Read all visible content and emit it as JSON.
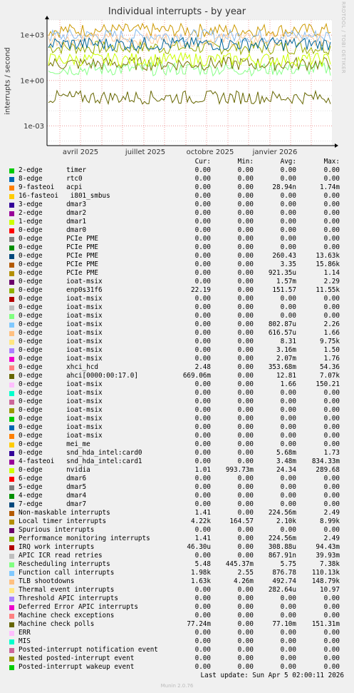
{
  "title": "Individual interrupts - by year",
  "ylabel": "interrupts / second",
  "watermark": "RRDTOOL / TOBI OETIKER",
  "footer": "Munin 2.0.76",
  "last_update": "Last update: Sun Apr  5 02:00:11 2026",
  "columns": {
    "cur": "Cur:",
    "min": "Min:",
    "avg": "Avg:",
    "max": "Max:"
  },
  "chart_data": {
    "type": "line",
    "title": "Individual interrupts - by year",
    "ylabel": "interrupts / second",
    "yscale": "log",
    "ylim": [
      5e-05,
      10000
    ],
    "yticks": [
      "1e+03",
      "1e+00",
      "1e-03"
    ],
    "xticks": [
      "avril 2025",
      "juillet 2025",
      "octobre 2025",
      "janvier 2026"
    ],
    "grid": true,
    "series": [
      {
        "name": "enp0s31f6",
        "color": "#99aa00",
        "avg": 151.57
      },
      {
        "name": "Local timer interrupts",
        "color": "#cc9900",
        "avg": 2100
      },
      {
        "name": "Function call interrupts",
        "color": "#88bbee",
        "avg": 876.78
      },
      {
        "name": "TLB shootdowns",
        "color": "#ffcc99",
        "avg": 492.74
      },
      {
        "name": "Rescheduling interrupts",
        "color": "#88ff88",
        "avg": 5.75
      },
      {
        "name": "ahci[0000:00:17.0]",
        "color": "#777700",
        "avg": 12.81
      },
      {
        "name": "nvidia",
        "color": "#ccff00",
        "avg": 24.34
      },
      {
        "name": "PCIe PME",
        "color": "#006699",
        "avg": 260.43
      },
      {
        "name": "Machine check polls",
        "color": "#666600",
        "avg": 0.0771
      }
    ]
  },
  "rows": [
    {
      "label": "2-edge      timer",
      "color": "#00cc00",
      "cur": "0.00",
      "min": "0.00",
      "avg": "0.00",
      "max": "0.00"
    },
    {
      "label": "8-edge      rtc0",
      "color": "#0066b3",
      "cur": "0.00",
      "min": "0.00",
      "avg": "0.00",
      "max": "0.00"
    },
    {
      "label": "9-fasteoi   acpi",
      "color": "#ff8000",
      "cur": "0.00",
      "min": "0.00",
      "avg": "28.94n",
      "max": "1.74m"
    },
    {
      "label": "16-fasteoi   i801_smbus",
      "color": "#ffcc00",
      "cur": "0.00",
      "min": "0.00",
      "avg": "0.00",
      "max": "0.00"
    },
    {
      "label": "3-edge      dmar3",
      "color": "#330099",
      "cur": "0.00",
      "min": "0.00",
      "avg": "0.00",
      "max": "0.00"
    },
    {
      "label": "2-edge      dmar2",
      "color": "#990099",
      "cur": "0.00",
      "min": "0.00",
      "avg": "0.00",
      "max": "0.00"
    },
    {
      "label": "1-edge      dmar1",
      "color": "#ccff00",
      "cur": "0.00",
      "min": "0.00",
      "avg": "0.00",
      "max": "0.00"
    },
    {
      "label": "0-edge      dmar0",
      "color": "#ff0000",
      "cur": "0.00",
      "min": "0.00",
      "avg": "0.00",
      "max": "0.00"
    },
    {
      "label": "0-edge      PCIe PME",
      "color": "#808080",
      "cur": "0.00",
      "min": "0.00",
      "avg": "0.00",
      "max": "0.00"
    },
    {
      "label": "0-edge      PCIe PME",
      "color": "#008f00",
      "cur": "0.00",
      "min": "0.00",
      "avg": "0.00",
      "max": "0.00"
    },
    {
      "label": "0-edge      PCIe PME",
      "color": "#00487d",
      "cur": "0.00",
      "min": "0.00",
      "avg": "260.43",
      "max": "13.63k"
    },
    {
      "label": "0-edge      PCIe PME",
      "color": "#b35a00",
      "cur": "0.00",
      "min": "0.00",
      "avg": "3.35",
      "max": "15.86k"
    },
    {
      "label": "0-edge      PCIe PME",
      "color": "#b38f00",
      "cur": "0.00",
      "min": "0.00",
      "avg": "921.35u",
      "max": "1.14"
    },
    {
      "label": "0-edge      ioat-msix",
      "color": "#6b006b",
      "cur": "0.00",
      "min": "0.00",
      "avg": "1.57m",
      "max": "2.29"
    },
    {
      "label": "0-edge      enp0s31f6",
      "color": "#8fb300",
      "cur": "22.19",
      "min": "0.00",
      "avg": "151.57",
      "max": "11.55k"
    },
    {
      "label": "0-edge      ioat-msix",
      "color": "#b30000",
      "cur": "0.00",
      "min": "0.00",
      "avg": "0.00",
      "max": "0.00"
    },
    {
      "label": "0-edge      ioat-msix",
      "color": "#bebebe",
      "cur": "0.00",
      "min": "0.00",
      "avg": "0.00",
      "max": "0.00"
    },
    {
      "label": "0-edge      ioat-msix",
      "color": "#80ff80",
      "cur": "0.00",
      "min": "0.00",
      "avg": "0.00",
      "max": "0.00"
    },
    {
      "label": "0-edge      ioat-msix",
      "color": "#80c9ff",
      "cur": "0.00",
      "min": "0.00",
      "avg": "802.87u",
      "max": "2.26"
    },
    {
      "label": "0-edge      ioat-msix",
      "color": "#ffc080",
      "cur": "0.00",
      "min": "0.00",
      "avg": "616.57u",
      "max": "1.66"
    },
    {
      "label": "0-edge      ioat-msix",
      "color": "#ffe680",
      "cur": "0.00",
      "min": "0.00",
      "avg": "8.31",
      "max": "9.75k"
    },
    {
      "label": "0-edge      ioat-msix",
      "color": "#aa80ff",
      "cur": "0.00",
      "min": "0.00",
      "avg": "3.16m",
      "max": "1.50"
    },
    {
      "label": "0-edge      ioat-msix",
      "color": "#ee00cc",
      "cur": "0.00",
      "min": "0.00",
      "avg": "2.07m",
      "max": "1.76"
    },
    {
      "label": "0-edge      xhci_hcd",
      "color": "#ff8080",
      "cur": "2.48",
      "min": "0.00",
      "avg": "353.68m",
      "max": "54.36"
    },
    {
      "label": "0-edge      ahci[0000:00:17.0]",
      "color": "#666600",
      "cur": "669.06m",
      "min": "0.00",
      "avg": "12.81",
      "max": "7.07k"
    },
    {
      "label": "0-edge      ioat-msix",
      "color": "#ffbfff",
      "cur": "0.00",
      "min": "0.00",
      "avg": "1.66",
      "max": "150.21"
    },
    {
      "label": "0-edge      ioat-msix",
      "color": "#00ffcc",
      "cur": "0.00",
      "min": "0.00",
      "avg": "0.00",
      "max": "0.00"
    },
    {
      "label": "0-edge      ioat-msix",
      "color": "#cc6699",
      "cur": "0.00",
      "min": "0.00",
      "avg": "0.00",
      "max": "0.00"
    },
    {
      "label": "0-edge      ioat-msix",
      "color": "#999900",
      "cur": "0.00",
      "min": "0.00",
      "avg": "0.00",
      "max": "0.00"
    },
    {
      "label": "0-edge      ioat-msix",
      "color": "#00cc00",
      "cur": "0.00",
      "min": "0.00",
      "avg": "0.00",
      "max": "0.00"
    },
    {
      "label": "0-edge      ioat-msix",
      "color": "#0066b3",
      "cur": "0.00",
      "min": "0.00",
      "avg": "0.00",
      "max": "0.00"
    },
    {
      "label": "0-edge      ioat-msix",
      "color": "#ff8000",
      "cur": "0.00",
      "min": "0.00",
      "avg": "0.00",
      "max": "0.00"
    },
    {
      "label": "0-edge      mei_me",
      "color": "#ffcc00",
      "cur": "0.00",
      "min": "0.00",
      "avg": "0.00",
      "max": "0.00"
    },
    {
      "label": "0-edge      snd_hda_intel:card0",
      "color": "#330099",
      "cur": "0.00",
      "min": "0.00",
      "avg": "5.68m",
      "max": "1.73"
    },
    {
      "label": "4-fasteoi   snd_hda_intel:card1",
      "color": "#990099",
      "cur": "0.00",
      "min": "0.00",
      "avg": "3.48m",
      "max": "834.33m"
    },
    {
      "label": "0-edge      nvidia",
      "color": "#ccff00",
      "cur": "1.01",
      "min": "993.73m",
      "avg": "24.34",
      "max": "289.68"
    },
    {
      "label": "6-edge      dmar6",
      "color": "#ff0000",
      "cur": "0.00",
      "min": "0.00",
      "avg": "0.00",
      "max": "0.00"
    },
    {
      "label": "5-edge      dmar5",
      "color": "#808080",
      "cur": "0.00",
      "min": "0.00",
      "avg": "0.00",
      "max": "0.00"
    },
    {
      "label": "4-edge      dmar4",
      "color": "#008f00",
      "cur": "0.00",
      "min": "0.00",
      "avg": "0.00",
      "max": "0.00"
    },
    {
      "label": "7-edge      dmar7",
      "color": "#00487d",
      "cur": "0.00",
      "min": "0.00",
      "avg": "0.00",
      "max": "0.00"
    },
    {
      "label": "Non-maskable interrupts",
      "color": "#b35a00",
      "cur": "1.41",
      "min": "0.00",
      "avg": "224.56m",
      "max": "2.49"
    },
    {
      "label": "Local timer interrupts",
      "color": "#b38f00",
      "cur": "4.22k",
      "min": "164.57",
      "avg": "2.10k",
      "max": "8.99k"
    },
    {
      "label": "Spurious interrupts",
      "color": "#6b006b",
      "cur": "0.00",
      "min": "0.00",
      "avg": "0.00",
      "max": "0.00"
    },
    {
      "label": "Performance monitoring interrupts",
      "color": "#8fb300",
      "cur": "1.41",
      "min": "0.00",
      "avg": "224.56m",
      "max": "2.49"
    },
    {
      "label": "IRQ work interrupts",
      "color": "#b30000",
      "cur": "46.30u",
      "min": "0.00",
      "avg": "308.88u",
      "max": "94.43m"
    },
    {
      "label": "APIC ICR read retries",
      "color": "#bebebe",
      "cur": "0.00",
      "min": "0.00",
      "avg": "867.91n",
      "max": "39.93m"
    },
    {
      "label": "Rescheduling interrupts",
      "color": "#80ff80",
      "cur": "5.48",
      "min": "445.37m",
      "avg": "5.75",
      "max": "7.38k"
    },
    {
      "label": "Function call interrupts",
      "color": "#80c9ff",
      "cur": "1.98k",
      "min": "2.55",
      "avg": "876.78",
      "max": "110.13k"
    },
    {
      "label": "TLB shootdowns",
      "color": "#ffc080",
      "cur": "1.63k",
      "min": "4.26m",
      "avg": "492.74",
      "max": "148.79k"
    },
    {
      "label": "Thermal event interrupts",
      "color": "#ffe680",
      "cur": "0.00",
      "min": "0.00",
      "avg": "282.64u",
      "max": "10.97"
    },
    {
      "label": "Threshold APIC interrupts",
      "color": "#aa80ff",
      "cur": "0.00",
      "min": "0.00",
      "avg": "0.00",
      "max": "0.00"
    },
    {
      "label": "Deferred Error APIC interrupts",
      "color": "#ee00cc",
      "cur": "0.00",
      "min": "0.00",
      "avg": "0.00",
      "max": "0.00"
    },
    {
      "label": "Machine check exceptions",
      "color": "#ff8080",
      "cur": "0.00",
      "min": "0.00",
      "avg": "0.00",
      "max": "0.00"
    },
    {
      "label": "Machine check polls",
      "color": "#666600",
      "cur": "77.24m",
      "min": "0.00",
      "avg": "77.10m",
      "max": "151.31m"
    },
    {
      "label": "ERR",
      "color": "#ffbfff",
      "cur": "0.00",
      "min": "0.00",
      "avg": "0.00",
      "max": "0.00"
    },
    {
      "label": "MIS",
      "color": "#00ffcc",
      "cur": "0.00",
      "min": "0.00",
      "avg": "0.00",
      "max": "0.00"
    },
    {
      "label": "Posted-interrupt notification event",
      "color": "#cc6699",
      "cur": "0.00",
      "min": "0.00",
      "avg": "0.00",
      "max": "0.00"
    },
    {
      "label": "Nested posted-interrupt event",
      "color": "#999900",
      "cur": "0.00",
      "min": "0.00",
      "avg": "0.00",
      "max": "0.00"
    },
    {
      "label": "Posted-interrupt wakeup event",
      "color": "#00cc00",
      "cur": "0.00",
      "min": "0.00",
      "avg": "0.00",
      "max": "0.00"
    }
  ]
}
